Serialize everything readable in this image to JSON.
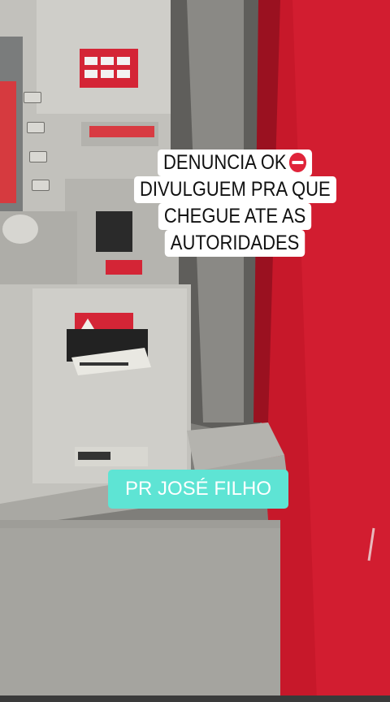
{
  "overlay": {
    "caption_lines": [
      "DENUNCIA OK",
      "DIVULGUEM PRA QUE",
      "CHEGUE ATE AS",
      "AUTORIDADES"
    ],
    "caption_icon": "no-entry-icon",
    "tag": "PR JOSÉ FILHO"
  },
  "colors": {
    "caption_bg": "#ffffff",
    "tag_bg": "#5ee4d4",
    "wall_red": "#c7182a",
    "atm_grey": "#b9b8b3"
  }
}
